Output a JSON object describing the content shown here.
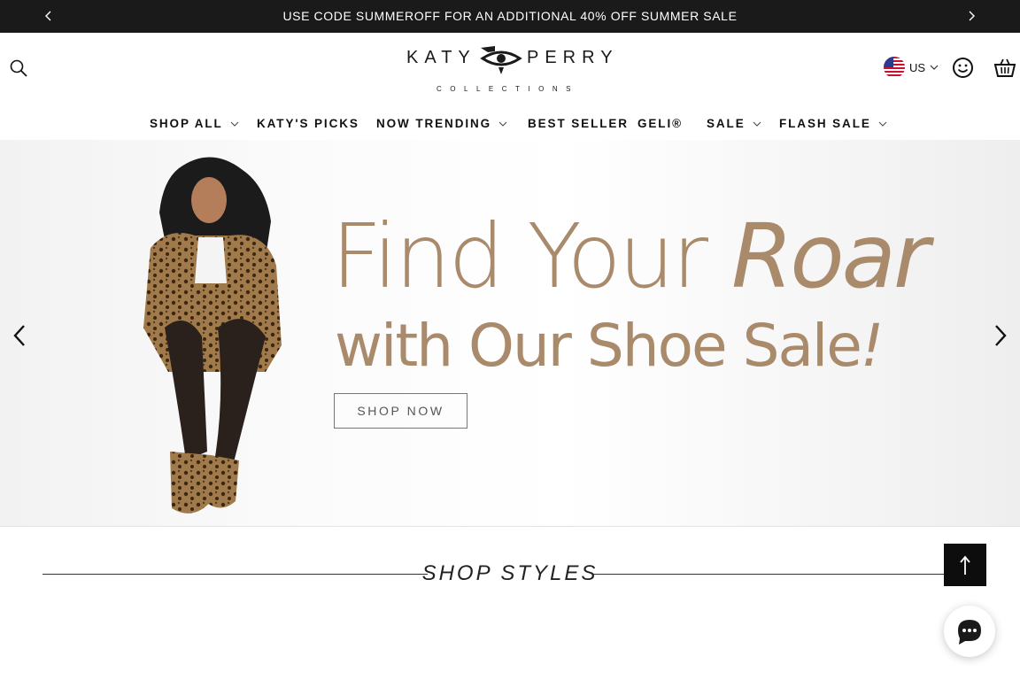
{
  "announcement": {
    "text": "USE CODE SUMMEROFF FOR AN ADDITIONAL 40% OFF SUMMER SALE",
    "prev_icon": "chevron-left-icon",
    "next_icon": "chevron-right-icon"
  },
  "header": {
    "logo": {
      "word_left": "KATY",
      "word_right": "PERRY",
      "subtitle": "COLLECTIONS"
    },
    "locale": {
      "label": "US",
      "flag": "us-flag-icon"
    },
    "icons": [
      "search-icon",
      "account-smiley-icon",
      "cart-basket-icon"
    ]
  },
  "nav": {
    "items": [
      {
        "label": "SHOP ALL",
        "has_dropdown": true
      },
      {
        "label": "KATY'S PICKS",
        "has_dropdown": false
      },
      {
        "label": "NOW TRENDING",
        "has_dropdown": true
      },
      {
        "label": "BEST SELLER",
        "has_dropdown": false
      },
      {
        "label": "GELI®",
        "has_dropdown": false
      },
      {
        "label": "SALE",
        "has_dropdown": true
      },
      {
        "label": "FLASH SALE",
        "has_dropdown": true
      }
    ]
  },
  "hero": {
    "line1_regular": "Find Your ",
    "line1_italic": "Roar",
    "line2_regular": "with Our Shoe Sale",
    "line2_italic": "!",
    "cta": "SHOP NOW",
    "accent_color": "#a98a6b"
  },
  "shop_styles": {
    "title": "SHOP STYLES"
  },
  "floating": {
    "back_to_top_icon": "arrow-up-icon",
    "chat_icon": "chat-bubble-icon"
  },
  "colors": {
    "announcement_bg": "#1a1a1a",
    "text": "#111111",
    "accent": "#a98a6b"
  }
}
